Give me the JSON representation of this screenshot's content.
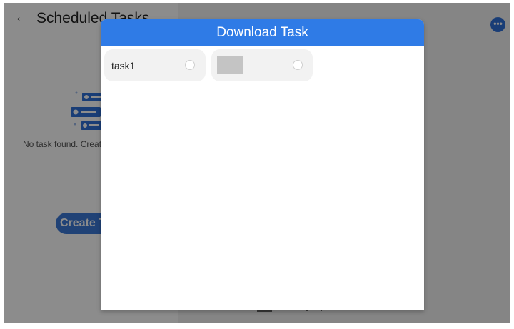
{
  "app": {
    "title": "Scheduled Tasks",
    "empty_text": "No task found. Create",
    "create_button_label": "Create Task",
    "back_icon": "←",
    "more_icon": "•••"
  },
  "dialog": {
    "title": "Download Task",
    "tasks": [
      {
        "label": "task1",
        "selected": false
      },
      {
        "label": "",
        "selected": false
      }
    ]
  },
  "colors": {
    "dialog_header": "#2f7be6",
    "create_button": "#3b79d7",
    "more_button": "#2f6fd8"
  }
}
